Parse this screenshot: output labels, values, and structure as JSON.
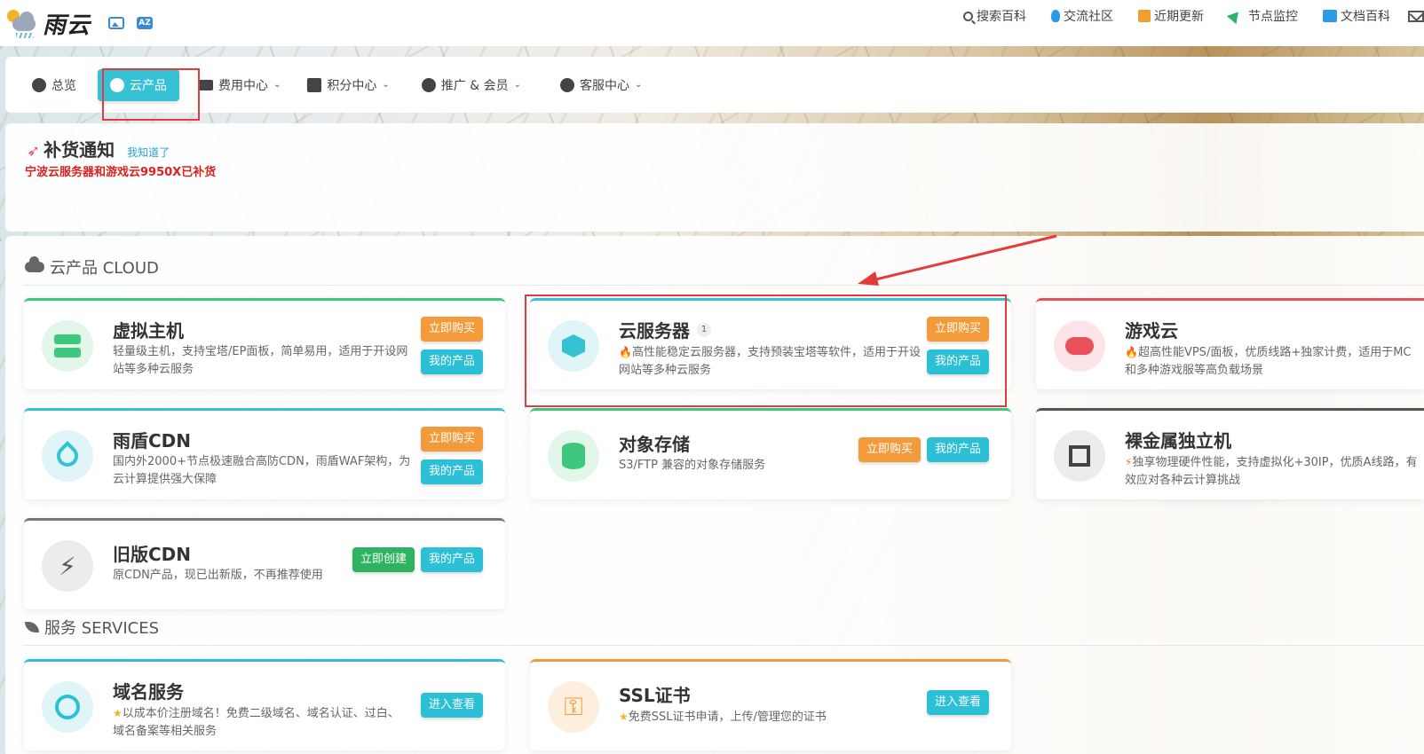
{
  "header": {
    "brand": "雨云",
    "nav": [
      {
        "label": "搜索百科",
        "icon": "search-icon"
      },
      {
        "label": "交流社区",
        "icon": "qq-icon"
      },
      {
        "label": "近期更新",
        "icon": "news-icon"
      },
      {
        "label": "节点监控",
        "icon": "plane-icon"
      },
      {
        "label": "文档百科",
        "icon": "book-icon"
      }
    ]
  },
  "mainnav": {
    "items": [
      {
        "label": "总览",
        "icon": "dashboard-icon"
      },
      {
        "label": "云产品",
        "icon": "cubes-icon",
        "active": true
      },
      {
        "label": "费用中心",
        "icon": "money-icon",
        "dropdown": true
      },
      {
        "label": "积分中心",
        "icon": "gift-icon",
        "dropdown": true
      },
      {
        "label": "推广 & 会员",
        "icon": "users-icon",
        "dropdown": true
      },
      {
        "label": "客服中心",
        "icon": "headset-icon",
        "dropdown": true
      }
    ]
  },
  "notice": {
    "title": "补货通知",
    "dismiss": "我知道了",
    "body": "宁波云服务器和游戏云9950X已补货"
  },
  "cloud_section": {
    "title": "云产品 CLOUD",
    "cards": [
      {
        "title": "虚拟主机",
        "desc": "轻量级主机，支持宝塔/EP面板，简单易用，适用于开设网站等多种云服务",
        "buy": "立即购买",
        "mine": "我的产品"
      },
      {
        "title": "云服务器",
        "badge": "1",
        "desc": "高性能稳定云服务器，支持预装宝塔等软件，适用于开设网站等多种云服务",
        "buy": "立即购买",
        "mine": "我的产品"
      },
      {
        "title": "游戏云",
        "desc": "超高性能VPS/面板，优质线路+独家计费，适用于MC和多种游戏服等高负载场景"
      },
      {
        "title": "雨盾CDN",
        "desc": "国内外2000+节点极速融合高防CDN，雨盾WAF架构，为云计算提供强大保障",
        "buy": "立即购买",
        "mine": "我的产品"
      },
      {
        "title": "对象存储",
        "desc": "S3/FTP 兼容的对象存储服务",
        "buy": "立即购买",
        "mine": "我的产品"
      },
      {
        "title": "裸金属独立机",
        "desc": "独享物理硬件性能，支持虚拟化+30IP，优质A线路，有效应对各种云计算挑战"
      },
      {
        "title": "旧版CDN",
        "desc": "原CDN产品，现已出新版，不再推荐使用",
        "create": "立即创建",
        "mine": "我的产品"
      }
    ]
  },
  "services_section": {
    "title": "服务 SERVICES",
    "cards": [
      {
        "title": "域名服务",
        "desc": "以成本价注册域名！免费二级域名、域名认证、过白、域名备案等相关服务",
        "enter": "进入查看"
      },
      {
        "title": "SSL证书",
        "desc": "免费SSL证书申请，上传/管理您的证书",
        "enter": "进入查看"
      }
    ]
  },
  "colors": {
    "accent": "#37c1d4",
    "buy": "#f39b3a",
    "mine": "#2bc0d6",
    "create": "#2eb461",
    "highlight": "#e33b3b",
    "notice_text": "#d9221e"
  }
}
